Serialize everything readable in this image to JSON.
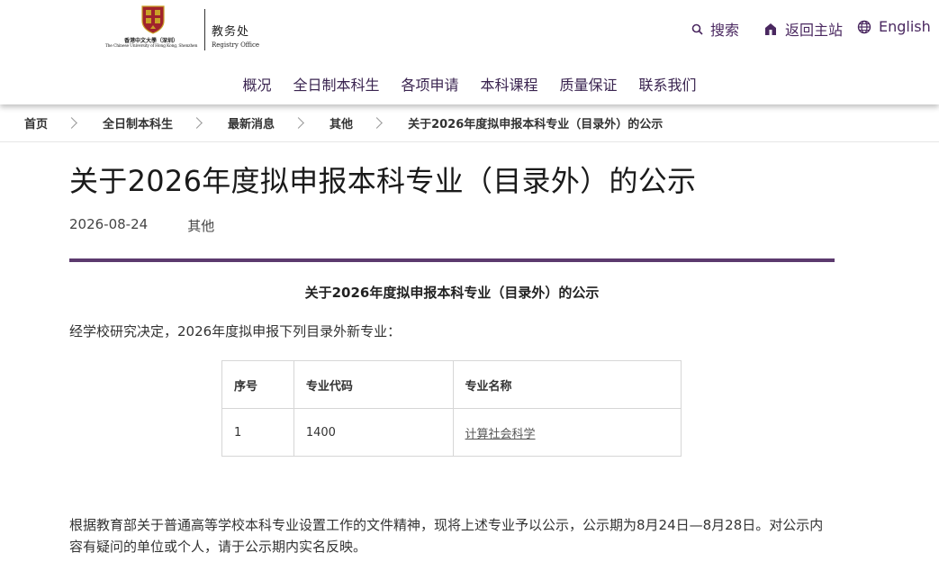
{
  "header": {
    "logo": {
      "university_cn": "香港中文大學（深圳）",
      "university_en": "The Chinese University of Hong Kong, Shenzhen",
      "office_cn": "教务处",
      "office_en": "Registry Office"
    },
    "utility": {
      "search": "搜索",
      "home": "返回主站",
      "language": "English"
    },
    "nav": [
      "概况",
      "全日制本科生",
      "各项申请",
      "本科课程",
      "质量保证",
      "联系我们"
    ]
  },
  "breadcrumb": [
    "首页",
    "全日制本科生",
    "最新消息",
    "其他",
    "关于2026年度拟申报本科专业（目录外）的公示"
  ],
  "article": {
    "title": "关于2026年度拟申报本科专业（目录外）的公示",
    "date": "2026-08-24",
    "category": "其他",
    "doc_heading": "关于2026年度拟申报本科专业（目录外）的公示",
    "intro": "经学校研究决定，2026年度拟申报下列目录外新专业：",
    "table": {
      "headers": [
        "序号",
        "专业代码",
        "专业名称"
      ],
      "rows": [
        [
          "1",
          "1400",
          "计算社会科学"
        ]
      ]
    },
    "closing": "根据教育部关于普通高等学校本科专业设置工作的文件精神，现将上述专业予以公示，公示期为8月24日—8月28日。对公示内容有疑问的单位或个人，请于公示期内实名反映。"
  },
  "colors": {
    "brand_purple": "#5c3a6e",
    "nav_text": "#3a2450",
    "crest_red": "#a0232d",
    "crest_gold": "#c9a227"
  },
  "icons": {
    "search": "search-icon",
    "home": "home-icon",
    "language": "globe-icon",
    "breadcrumb_separator": "chevron-right-icon"
  }
}
